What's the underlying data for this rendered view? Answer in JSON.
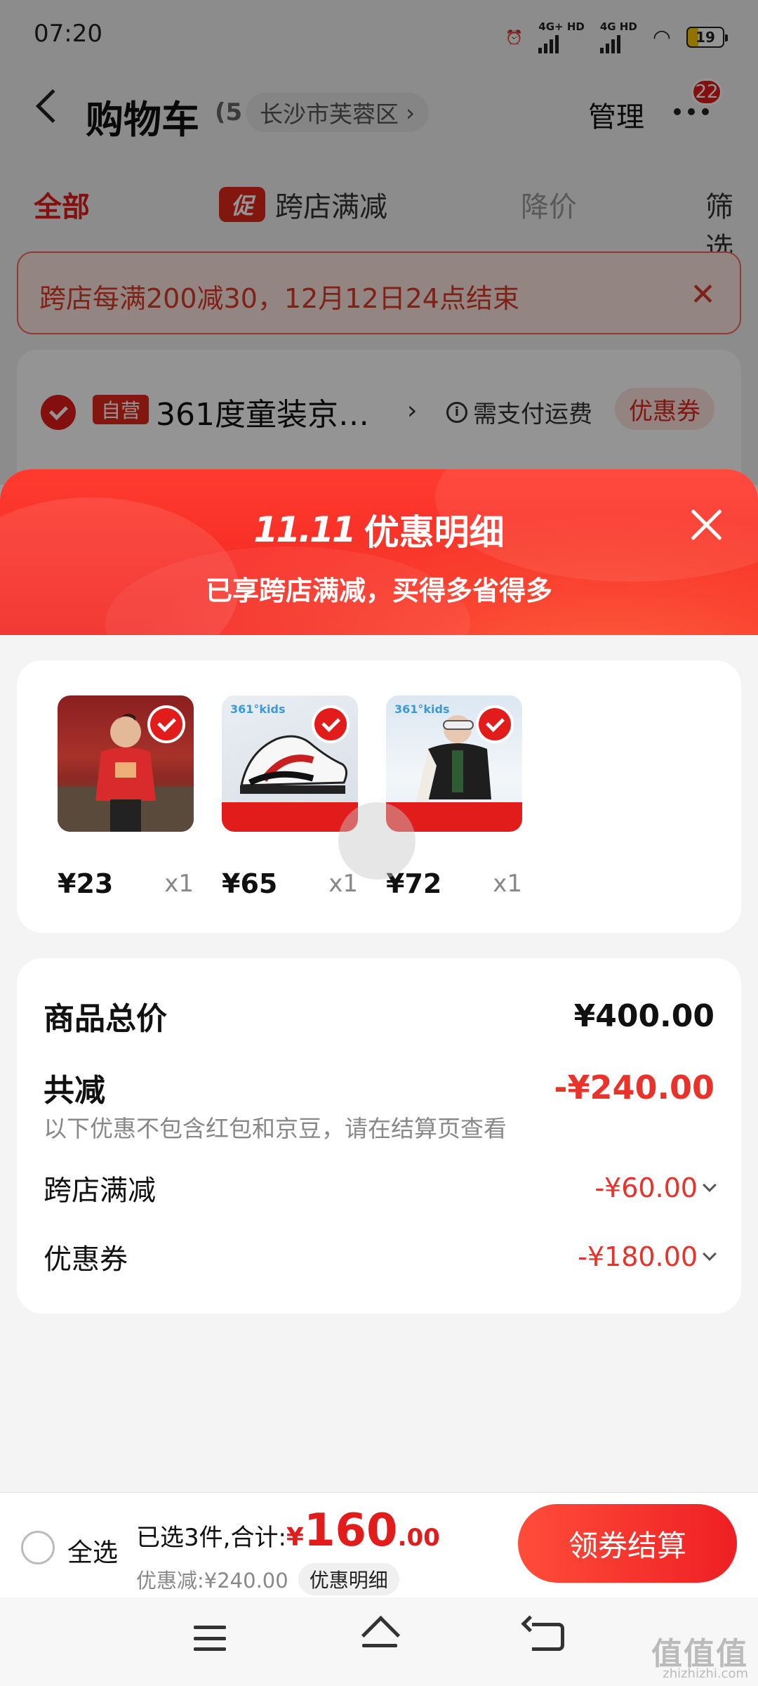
{
  "status": {
    "time": "07:20",
    "net1": "4G+ HD",
    "net2": "4G HD",
    "battery": "19"
  },
  "navbar": {
    "back_icon": "chevron-left-icon",
    "title": "购物车",
    "count": "(5",
    "location": "长沙市芙蓉区",
    "manage": "管理",
    "message_badge": "22"
  },
  "tabs": [
    {
      "label": "全部",
      "active": true
    },
    {
      "tag": "促",
      "label": "跨店满减"
    },
    {
      "label": "降价"
    },
    {
      "label": "筛选"
    }
  ],
  "promo_banner": {
    "text": "跨店每满200减30，12月12日24点结束"
  },
  "shop": {
    "badge": "自营",
    "name": "361度童装京…",
    "freight": "需支付运费",
    "coupon": "优惠券"
  },
  "sheet": {
    "logo": "11.11",
    "title": "优惠明细",
    "subtitle": "已享跨店满减，买得多省得多",
    "products": [
      {
        "price": "¥23",
        "qty": "x1",
        "image": "red-sweater-kid-photo"
      },
      {
        "price": "¥65",
        "qty": "x1",
        "image": "sneaker-photo",
        "brand": "361°kids"
      },
      {
        "price": "¥72",
        "qty": "x1",
        "image": "winter-jacket-kid-photo",
        "brand": "361°kids"
      }
    ],
    "summary": {
      "total_label": "商品总价",
      "total_value": "¥400.00",
      "reduce_label": "共减",
      "reduce_value": "-¥240.00",
      "note": "以下优惠不包含红包和京豆，请在结算页查看",
      "discounts": [
        {
          "label": "跨店满减",
          "value": "-¥60.00"
        },
        {
          "label": "优惠券",
          "value": "-¥180.00"
        }
      ]
    }
  },
  "checkout": {
    "select_all": "全选",
    "selected_text": "已选3件,合计:",
    "yen": "¥",
    "total_int": "160",
    "total_dec": ".00",
    "reduced_text": "优惠减:¥240.00",
    "detail_button": "优惠明细",
    "checkout_button": "领券结算"
  },
  "watermark": {
    "text": "值值值",
    "sub": "zhizhizhi.com"
  },
  "colors": {
    "accent": "#e21b1b",
    "discount": "#e8322a"
  }
}
